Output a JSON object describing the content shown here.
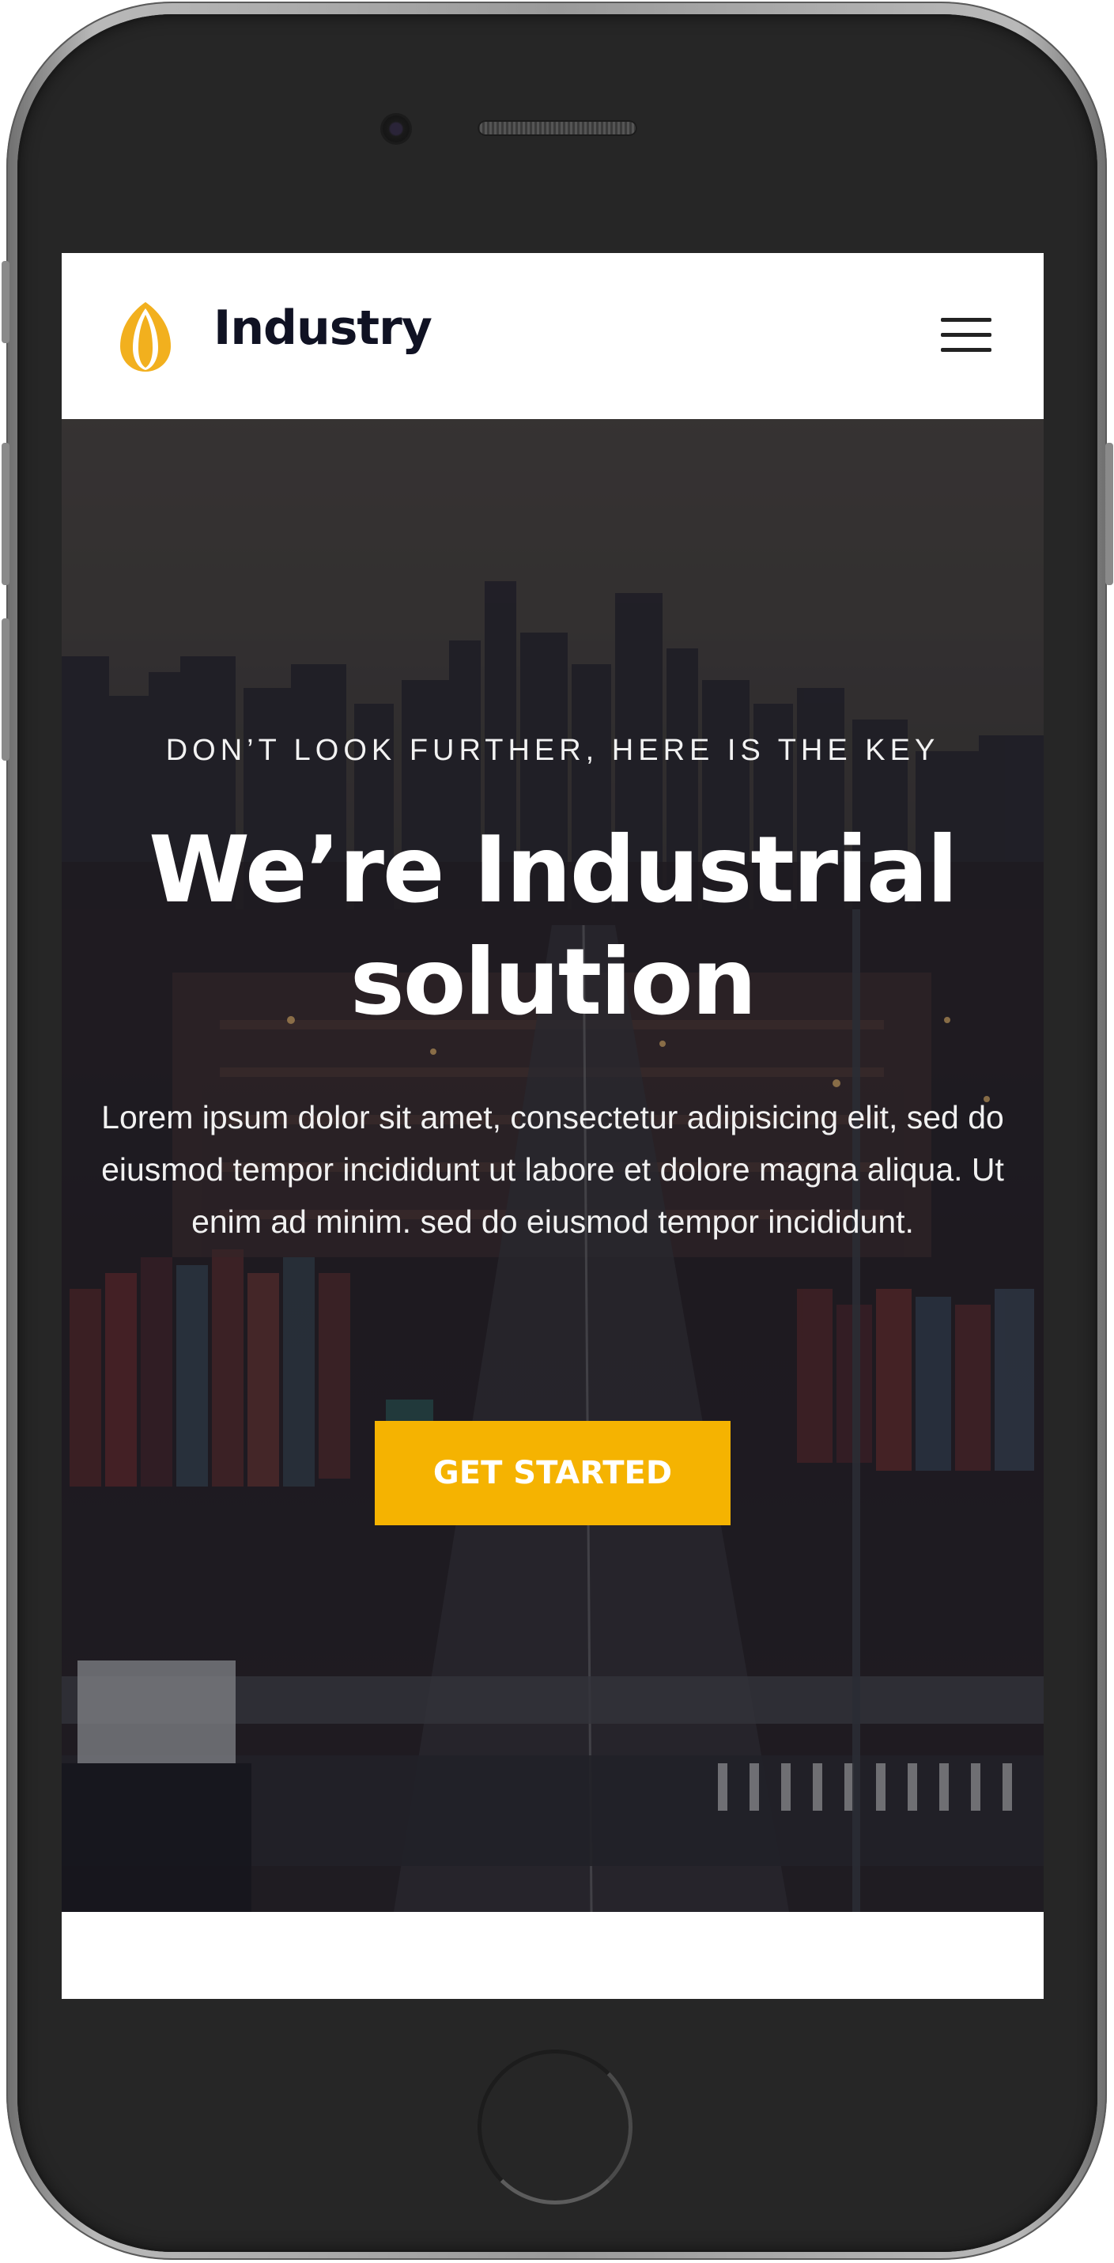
{
  "navbar": {
    "brand_name": "Industry",
    "logo_icon": "flame-petal-logo",
    "menu_icon": "hamburger-menu-icon"
  },
  "hero": {
    "eyebrow": "DON’T LOOK FURTHER, HERE IS THE KEY",
    "headline": "We’re Industrial solution",
    "description": "Lorem ipsum dolor sit amet, consectetur adipisicing elit, sed do eiusmod tempor incididunt ut labore et dolore magna aliqua. Ut enim ad minim. sed do eiusmod tempor incididunt.",
    "cta_label": "GET STARTED"
  },
  "colors": {
    "accent": "#f5b301",
    "brand_text": "#101223",
    "hero_overlay": "#1c1a20"
  }
}
